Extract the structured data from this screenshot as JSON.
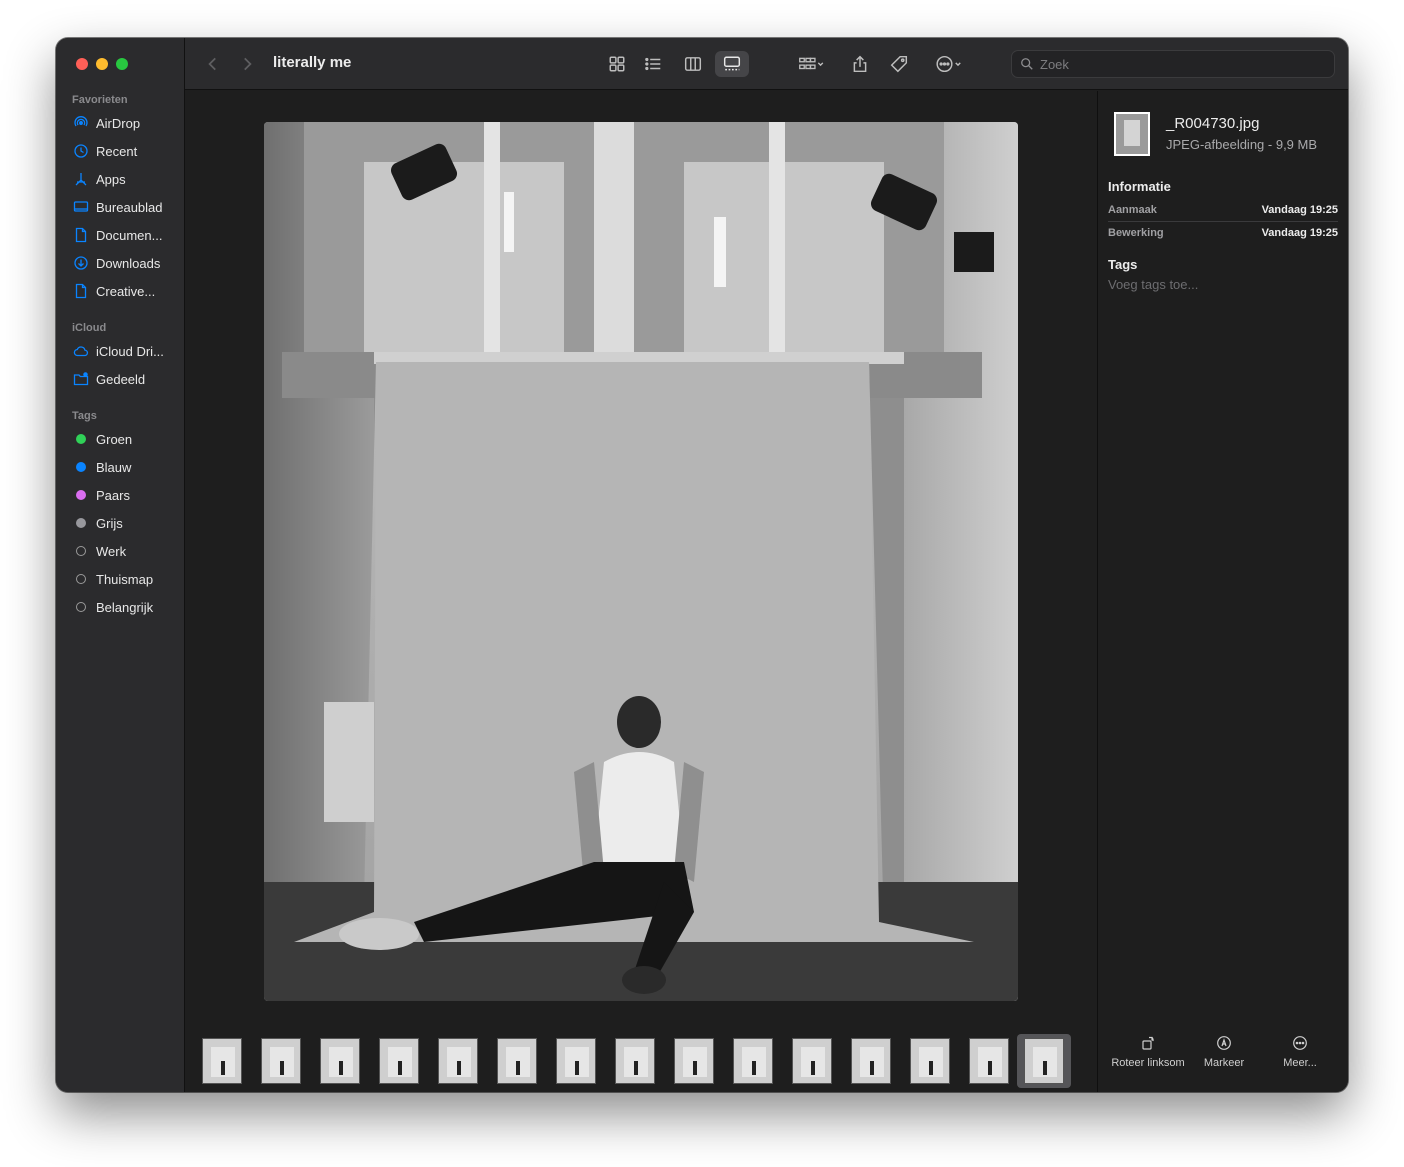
{
  "window": {
    "title": "literally me"
  },
  "sidebar": {
    "sections": [
      {
        "label": "Favorieten",
        "items": [
          {
            "label": "AirDrop",
            "icon": "airdrop-icon"
          },
          {
            "label": "Recent",
            "icon": "clock-icon"
          },
          {
            "label": "Apps",
            "icon": "apps-icon"
          },
          {
            "label": "Bureaublad",
            "icon": "desktop-icon"
          },
          {
            "label": "Documen...",
            "icon": "document-icon"
          },
          {
            "label": "Downloads",
            "icon": "download-icon"
          },
          {
            "label": "Creative...",
            "icon": "document-icon"
          }
        ]
      },
      {
        "label": "iCloud",
        "items": [
          {
            "label": "iCloud Dri...",
            "icon": "cloud-icon"
          },
          {
            "label": "Gedeeld",
            "icon": "shared-folder-icon"
          }
        ]
      },
      {
        "label": "Tags",
        "items": [
          {
            "label": "Groen",
            "color": "#30d158"
          },
          {
            "label": "Blauw",
            "color": "#0a84ff"
          },
          {
            "label": "Paars",
            "color": "#da6ef0"
          },
          {
            "label": "Grijs",
            "color": "#98989d"
          },
          {
            "label": "Werk",
            "color": ""
          },
          {
            "label": "Thuismap",
            "color": ""
          },
          {
            "label": "Belangrijk",
            "color": ""
          }
        ]
      }
    ]
  },
  "toolbar": {
    "search_placeholder": "Zoek",
    "view_mode_selected": "gallery"
  },
  "preview": {
    "thumbnail_count": 15,
    "selected_thumbnail": 14
  },
  "inspector": {
    "file_name": "_R004730.jpg",
    "file_kind": "JPEG-afbeelding - 9,9 MB",
    "info_heading": "Informatie",
    "rows": [
      {
        "key": "Aanmaak",
        "value": "Vandaag 19:25"
      },
      {
        "key": "Bewerking",
        "value": "Vandaag 19:25"
      }
    ],
    "tags_heading": "Tags",
    "tags_placeholder": "Voeg tags toe...",
    "actions": [
      {
        "label": "Roteer linksom",
        "icon": "rotate-left-icon"
      },
      {
        "label": "Markeer",
        "icon": "markup-icon"
      },
      {
        "label": "Meer...",
        "icon": "more-icon"
      }
    ]
  },
  "colors": {
    "accent": "#0a84ff",
    "sidebar_bg": "#2b2b2d",
    "content_bg": "#1e1e1e"
  }
}
